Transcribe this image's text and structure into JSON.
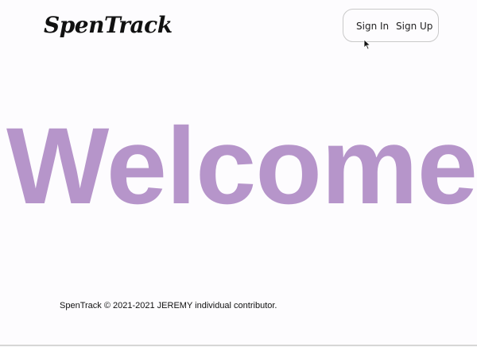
{
  "header": {
    "logo_text": "SpenTrack",
    "nav": {
      "sign_in": "Sign In",
      "sign_up": "Sign Up"
    }
  },
  "main": {
    "heading": "Welcome",
    "heading_color": "#b695ca"
  },
  "footer": {
    "text": "SpenTrack © 2021-2021 JEREMY individual contributor."
  },
  "icons": {
    "cursor": "mouse-pointer-icon"
  }
}
